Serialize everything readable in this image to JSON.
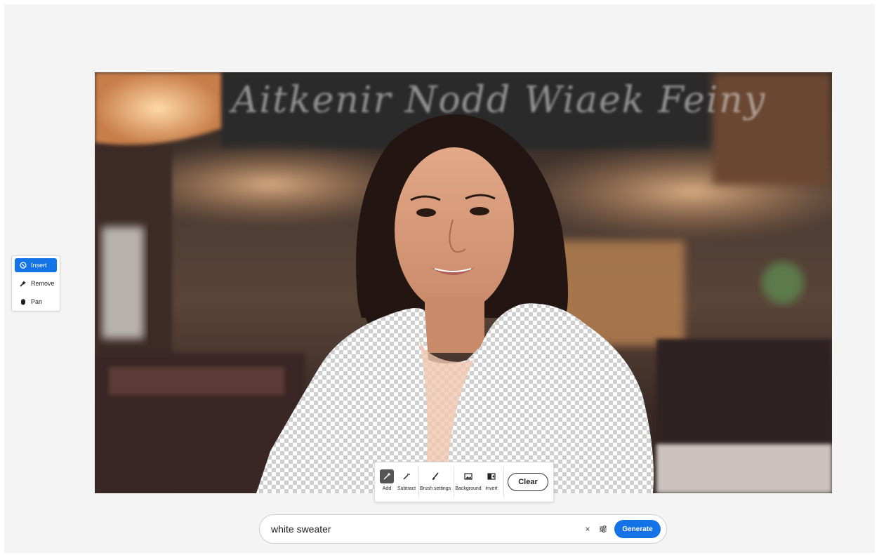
{
  "tools": {
    "insert_label": "Insert",
    "remove_label": "Remove",
    "pan_label": "Pan",
    "active": "insert"
  },
  "mask_toolbar": {
    "add_label": "Add",
    "subtract_label": "Subtract",
    "brush_settings_label": "Brush settings",
    "background_label": "Background",
    "invert_label": "Invert",
    "clear_label": "Clear",
    "active": "add"
  },
  "photo": {
    "chalkboard_text": "Aitkenir Nodd Wiaek Feiny"
  },
  "prompt": {
    "value": "white sweater",
    "generate_label": "Generate",
    "clear_icon": "×"
  },
  "colors": {
    "accent": "#1473e6",
    "canvas_bg": "#f4f4f4"
  }
}
